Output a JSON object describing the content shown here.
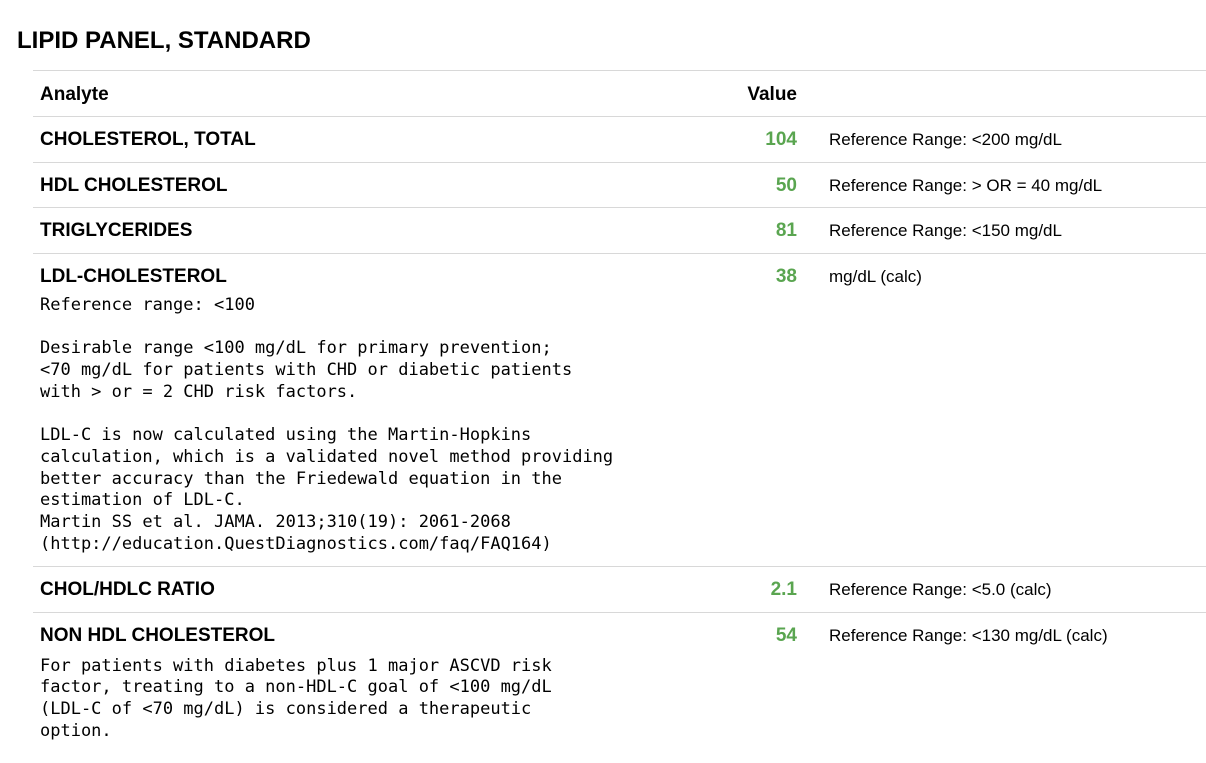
{
  "panel": {
    "title": "LIPID PANEL, STANDARD"
  },
  "colors": {
    "value_normal": "#5aa550",
    "divider": "#d8d8d8"
  },
  "table": {
    "headers": {
      "analyte": "Analyte",
      "value": "Value"
    },
    "rows": [
      {
        "analyte": "CHOLESTEROL, TOTAL",
        "value": "104",
        "reference": "Reference Range: <200 mg/dL",
        "comment": ""
      },
      {
        "analyte": "HDL CHOLESTEROL",
        "value": "50",
        "reference": "Reference Range: > OR = 40 mg/dL",
        "comment": ""
      },
      {
        "analyte": "TRIGLYCERIDES",
        "value": "81",
        "reference": "Reference Range: <150 mg/dL",
        "comment": ""
      },
      {
        "analyte": "LDL-CHOLESTEROL",
        "value": "38",
        "reference": "mg/dL (calc)",
        "comment": "Reference range: <100\n\nDesirable range <100 mg/dL for primary prevention;\n<70 mg/dL for patients with CHD or diabetic patients\nwith > or = 2 CHD risk factors.\n\nLDL-C is now calculated using the Martin-Hopkins\ncalculation, which is a validated novel method providing\nbetter accuracy than the Friedewald equation in the\nestimation of LDL-C.\nMartin SS et al. JAMA. 2013;310(19): 2061-2068\n(http://education.QuestDiagnostics.com/faq/FAQ164)"
      },
      {
        "analyte": "CHOL/HDLC RATIO",
        "value": "2.1",
        "reference": "Reference Range: <5.0 (calc)",
        "comment": ""
      },
      {
        "analyte": "NON HDL CHOLESTEROL",
        "value": "54",
        "reference": "Reference Range: <130 mg/dL (calc)",
        "comment": "For patients with diabetes plus 1 major ASCVD risk\nfactor, treating to a non-HDL-C goal of <100 mg/dL\n(LDL-C of <70 mg/dL) is considered a therapeutic\noption."
      }
    ]
  }
}
